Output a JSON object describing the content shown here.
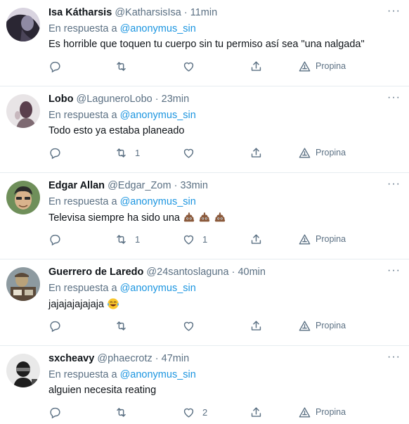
{
  "tweets": [
    {
      "name": "Isa Kátharsis",
      "handle": "@KatharsisIsa",
      "separator": "·",
      "time": "11min",
      "reply_prefix": "En respuesta a",
      "reply_to": "@anonymus_sin",
      "text": "Es horrible que toquen tu cuerpo sin tu permiso así sea \"una nalgada\"",
      "emoji": "",
      "retweets": "",
      "likes": "",
      "promote_label": "Propina",
      "avatar_colors": [
        "#2a2633",
        "#8f8aa3",
        "#d9d4e0"
      ]
    },
    {
      "name": "Lobo",
      "handle": "@LaguneroLobo",
      "separator": "·",
      "time": "23min",
      "reply_prefix": "En respuesta a",
      "reply_to": "@anonymus_sin",
      "text": "Todo esto ya estaba planeado",
      "emoji": "",
      "retweets": "1",
      "likes": "",
      "promote_label": "Propina",
      "avatar_colors": [
        "#e8e4e6",
        "#5a3f4d",
        "#c7b7bd"
      ]
    },
    {
      "name": "Edgar Allan",
      "handle": "@Edgar_Zom",
      "separator": "·",
      "time": "33min",
      "reply_prefix": "En respuesta a",
      "reply_to": "@anonymus_sin",
      "text": "Televisa siempre ha sido una",
      "emoji": "poop-emoji-x3",
      "retweets": "1",
      "likes": "1",
      "promote_label": "Propina",
      "avatar_colors": [
        "#6f8f5a",
        "#d9b38c",
        "#2b2b2b"
      ]
    },
    {
      "name": "Guerrero de Laredo",
      "handle": "@24santoslaguna",
      "separator": "·",
      "time": "40min",
      "reply_prefix": "En respuesta a",
      "reply_to": "@anonymus_sin",
      "text": "jajajajajajaja",
      "emoji": "tears-of-joy-emoji",
      "retweets": "",
      "likes": "",
      "promote_label": "Propina",
      "avatar_colors": [
        "#b9a27a",
        "#5b4a3a",
        "#8d9aa0"
      ]
    },
    {
      "name": "sxcheavy",
      "handle": "@phaecrotz",
      "separator": "·",
      "time": "47min",
      "reply_prefix": "En respuesta a",
      "reply_to": "@anonymus_sin",
      "text": "alguien necesita reating",
      "emoji": "",
      "retweets": "",
      "likes": "2",
      "promote_label": "Propina",
      "avatar_colors": [
        "#e9e9e9",
        "#1e1e1e",
        "#7a7a7a"
      ]
    }
  ],
  "more_icon": "more-horizontal-icon",
  "colors": {
    "text": "#0f1419",
    "secondary": "#5b7083",
    "link": "#1b95e0",
    "divider": "#e6ecf0"
  }
}
